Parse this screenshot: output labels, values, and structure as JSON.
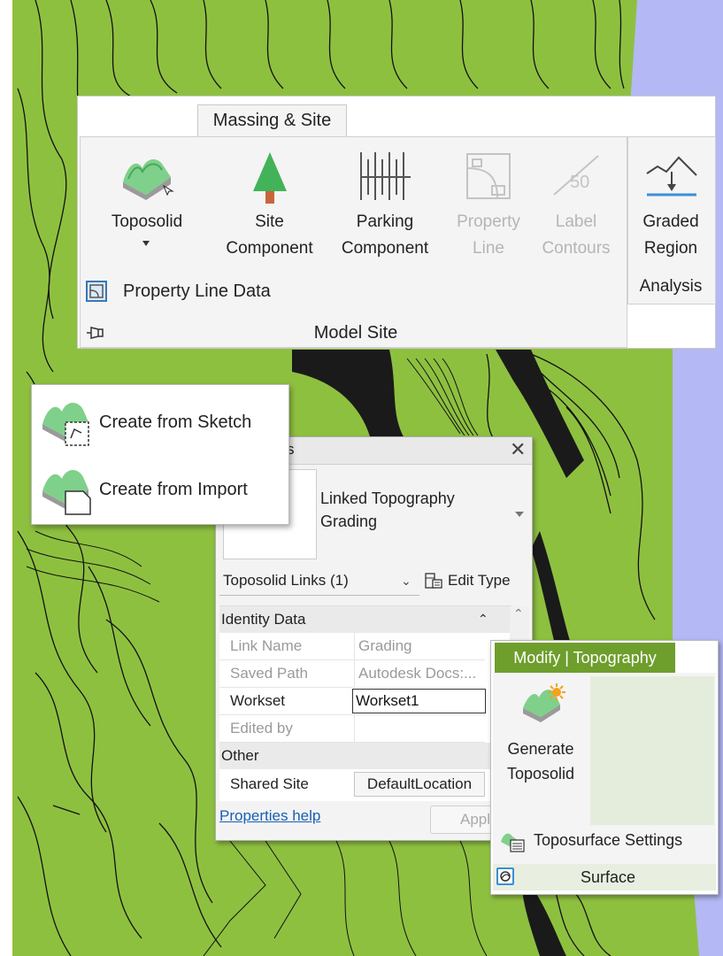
{
  "ribbon": {
    "tab": "Massing & Site",
    "buttons": {
      "toposolid": "Toposolid",
      "site_component": [
        "Site",
        "Component"
      ],
      "parking_component": [
        "Parking",
        "Component"
      ],
      "property_line": [
        "Property",
        "Line"
      ],
      "label_contours": [
        "Label",
        "Contours"
      ],
      "graded_region": [
        "Graded",
        "Region"
      ]
    },
    "label_contours_number": "50",
    "property_line_data": "Property Line Data",
    "panel_model_site": "Model Site",
    "panel_analysis": "Analysis"
  },
  "dropdown": {
    "items": [
      "Create from Sketch",
      "Create from Import"
    ]
  },
  "properties": {
    "title_fragment": "s",
    "type_name": [
      "Linked Topography",
      "Grading"
    ],
    "filter_label": "Toposolid Links (1)",
    "edit_type": "Edit Type",
    "groups": {
      "identity": "Identity Data",
      "other": "Other"
    },
    "rows": [
      {
        "name": "Link Name",
        "value": "Grading",
        "editable": false
      },
      {
        "name": "Saved Path",
        "value": "Autodesk Docs:...",
        "editable": false
      },
      {
        "name": "Workset",
        "value": "Workset1",
        "editable": true
      },
      {
        "name": "Edited by",
        "value": "",
        "editable": false
      }
    ],
    "other_rows": [
      {
        "name": "Shared Site",
        "value": "DefaultLocation"
      }
    ],
    "help_link": "Properties help",
    "apply_fragment": "Appl"
  },
  "contextual": {
    "tab": "Modify | Topography",
    "generate": [
      "Generate",
      "Toposolid"
    ],
    "toposurface_settings": "Toposurface Settings",
    "panel_surface": "Surface"
  },
  "colors": {
    "terrain": "#8ec040",
    "contour": "#111111",
    "sky": "#b4b8f4",
    "context_tab": "#6e9e2c",
    "link": "#1a5fb4"
  }
}
